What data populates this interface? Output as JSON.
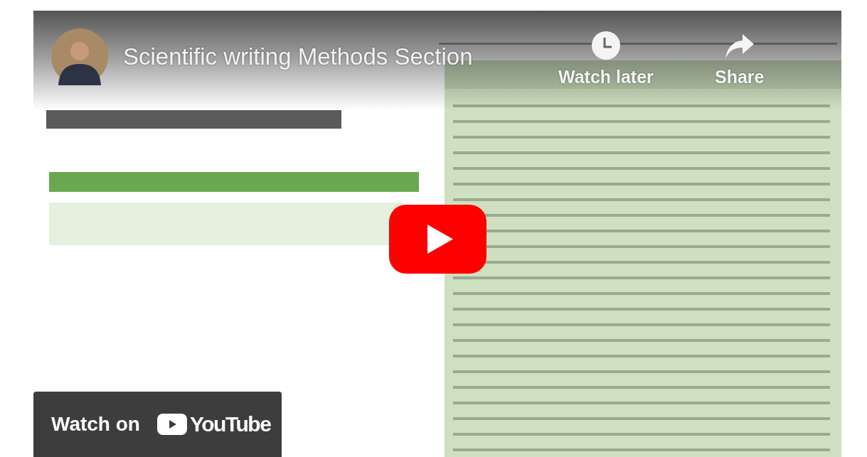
{
  "title": "Scientific writing Methods Section",
  "actions": [
    {
      "kind": "watch_later",
      "label": "Watch later"
    },
    {
      "kind": "share",
      "label": "Share"
    }
  ],
  "watch_on": {
    "label": "Watch on",
    "brand": "YouTube"
  }
}
